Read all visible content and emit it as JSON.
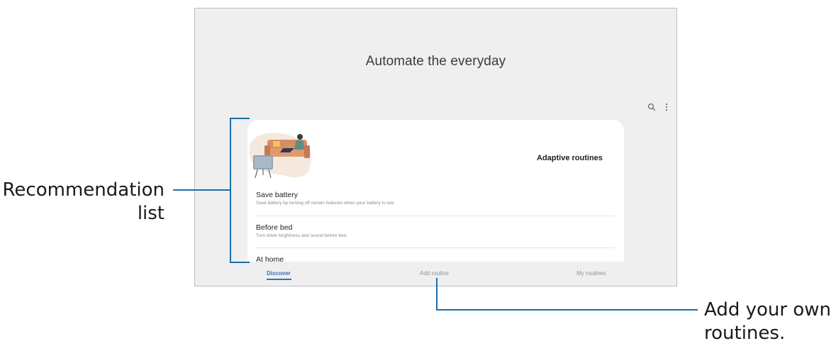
{
  "screen": {
    "title": "Automate the everyday",
    "card": {
      "heading": "Adaptive routines",
      "items": [
        {
          "title": "Save battery",
          "subtitle": "Save battery by turning off certain features when your battery is low."
        },
        {
          "title": "Before bed",
          "subtitle": "Turn down brightness and sound before bed."
        },
        {
          "title": "At home",
          "subtitle": ""
        }
      ]
    },
    "tabs": [
      {
        "label": "Discover",
        "active": true
      },
      {
        "label": "Add routine",
        "active": false
      },
      {
        "label": "My routines",
        "active": false
      }
    ],
    "icons": [
      "search-icon",
      "more-options-icon"
    ]
  },
  "callouts": {
    "recommendation": "Recommendation list",
    "add_routine": "Add your own routines."
  },
  "colors": {
    "accent": "#3a6fb3",
    "leader_line": "#1a6fa8",
    "screen_bg": "#efefef"
  }
}
